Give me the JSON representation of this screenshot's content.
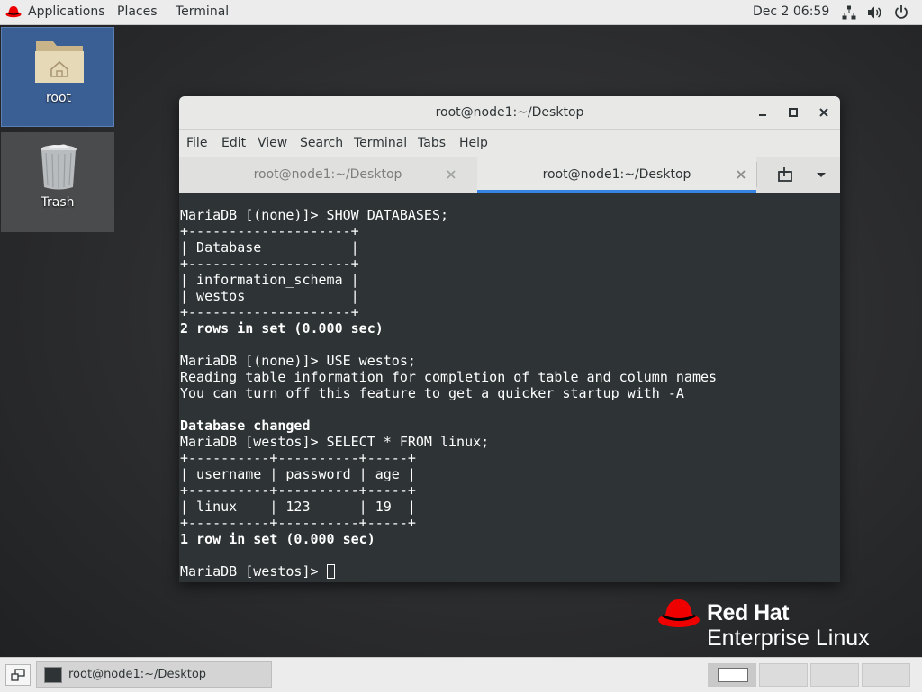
{
  "topbar": {
    "applications": "Applications",
    "places": "Places",
    "terminal": "Terminal",
    "clock": "Dec 2  06:59"
  },
  "desktop": {
    "icons": [
      {
        "label": "root",
        "icon": "home-folder-icon"
      },
      {
        "label": "Trash",
        "icon": "trash-icon"
      }
    ]
  },
  "window": {
    "title": "root@node1:~/Desktop",
    "menu": [
      "File",
      "Edit",
      "View",
      "Search",
      "Terminal",
      "Tabs",
      "Help"
    ],
    "tabs": [
      {
        "label": "root@node1:~/Desktop",
        "active": false
      },
      {
        "label": "root@node1:~/Desktop",
        "active": true
      }
    ]
  },
  "terminal": {
    "lines": [
      "MariaDB [(none)]> SHOW DATABASES;",
      "+--------------------+",
      "| Database           |",
      "+--------------------+",
      "| information_schema |",
      "| westos             |",
      "+--------------------+",
      "2 rows in set (0.000 sec)",
      "",
      "MariaDB [(none)]> USE westos;",
      "Reading table information for completion of table and column names",
      "You can turn off this feature to get a quicker startup with -A",
      "",
      "Database changed",
      "MariaDB [westos]> SELECT * FROM linux;",
      "+----------+----------+-----+",
      "| username | password | age |",
      "+----------+----------+-----+",
      "| linux    | 123      | 19  |",
      "+----------+----------+-----+",
      "1 row in set (0.000 sec)",
      "",
      "MariaDB [westos]> "
    ],
    "bold_lines": [
      7,
      13,
      20
    ]
  },
  "branding": {
    "line1": "Red Hat",
    "line2": "Enterprise Linux",
    "accent": "#ee0000"
  },
  "taskbar": {
    "task_label": "root@node1:~/Desktop",
    "workspaces": 4,
    "active_workspace": 1
  },
  "colors": {
    "terminal_bg": "#2e3436",
    "tab_active_underline": "#3584e4",
    "panel_bg": "#ececec"
  }
}
